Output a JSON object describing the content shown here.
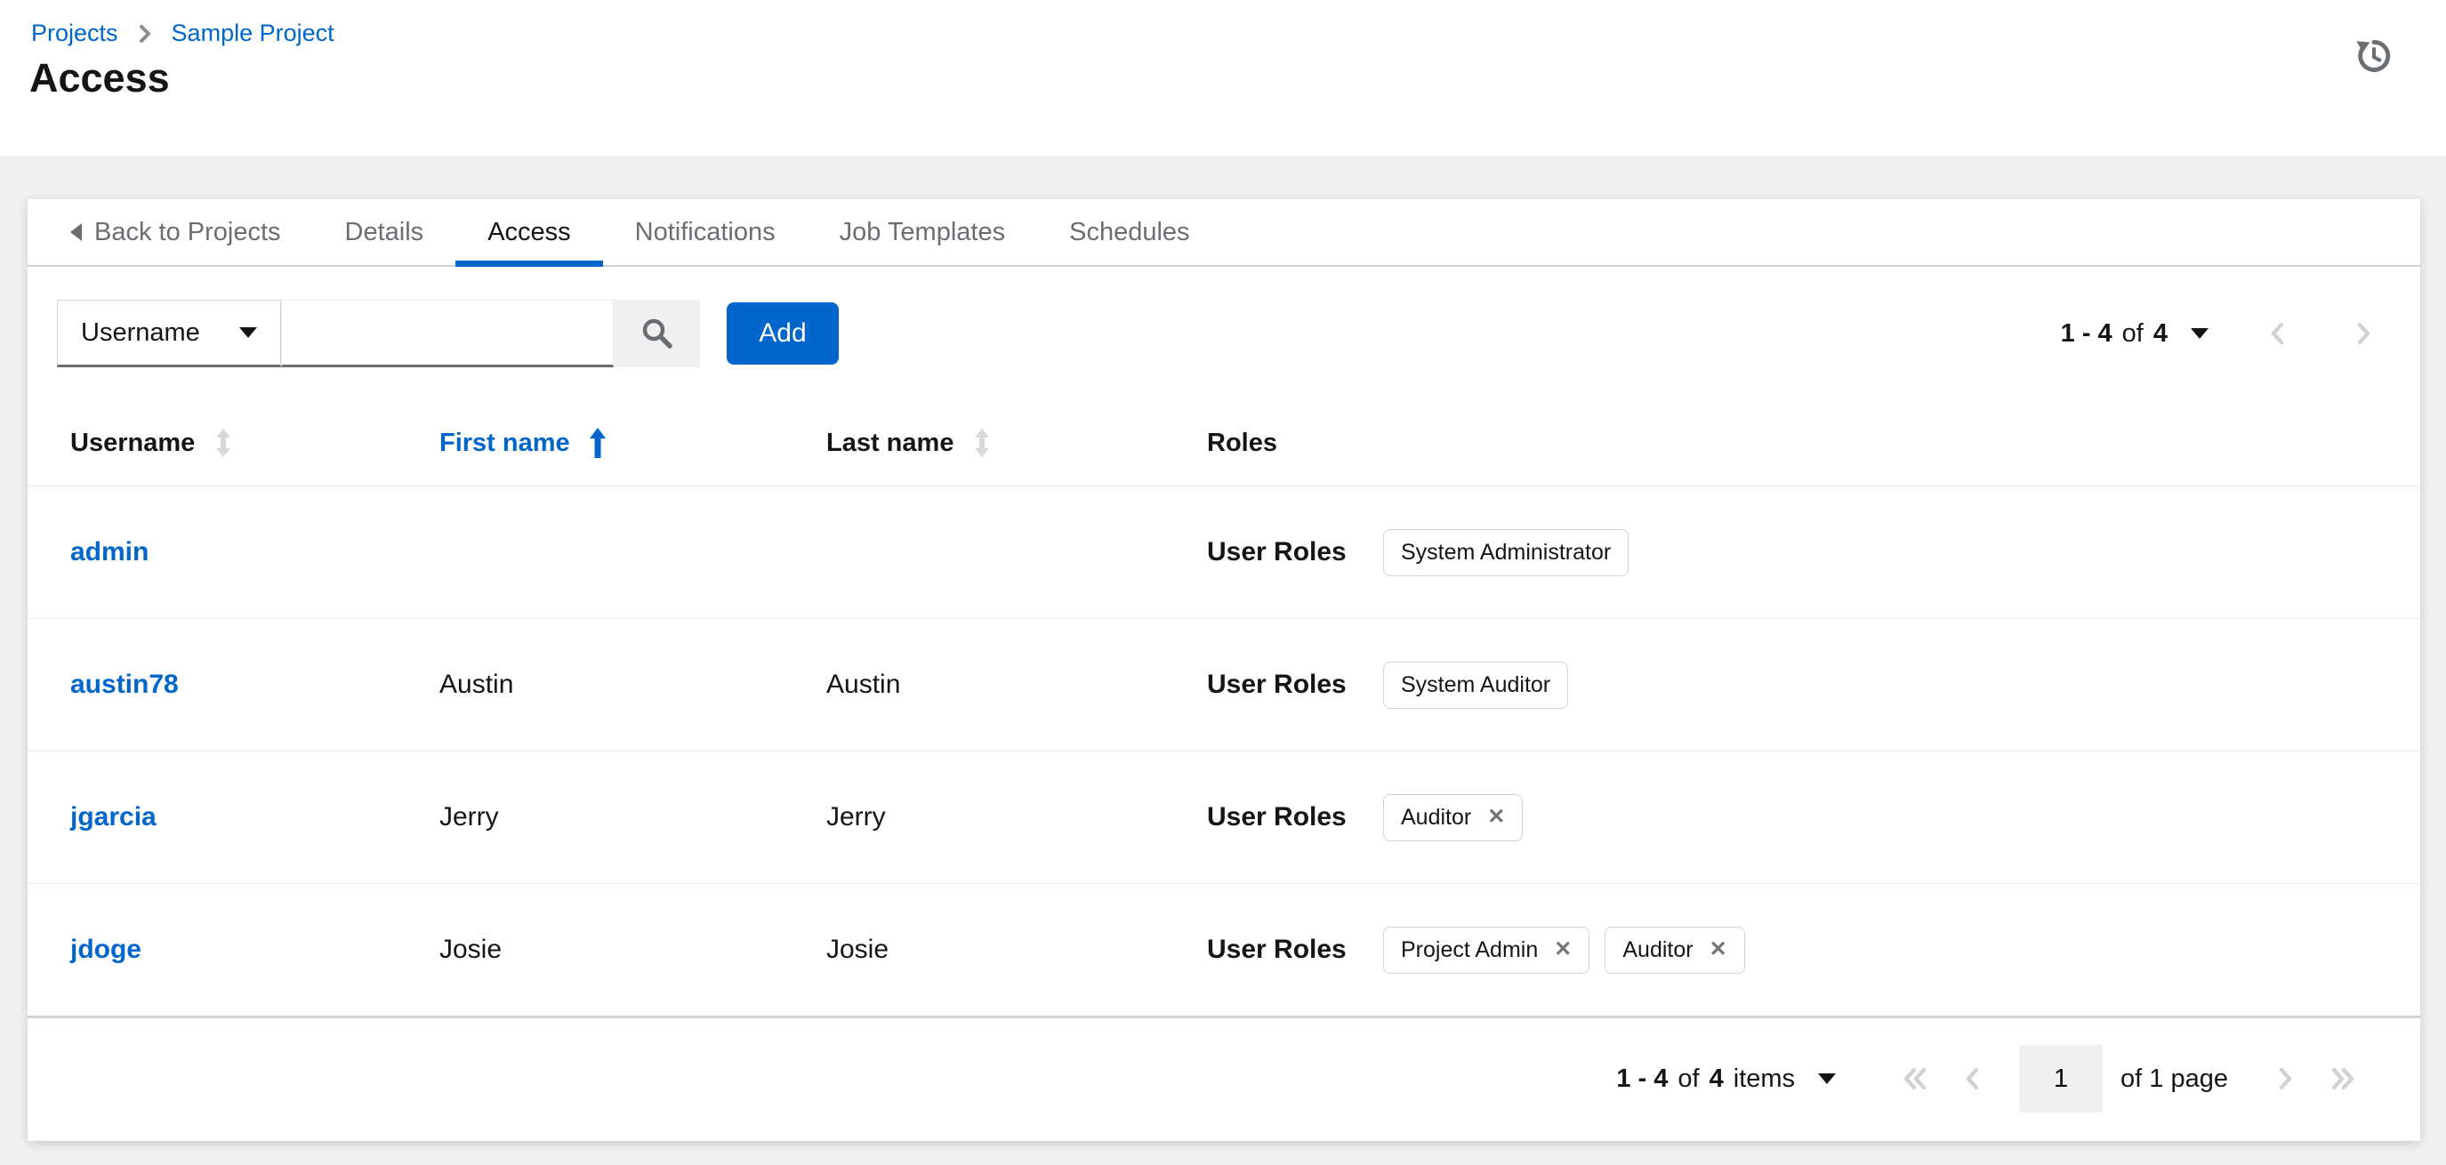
{
  "header": {
    "breadcrumb": [
      {
        "label": "Projects"
      },
      {
        "label": "Sample Project"
      }
    ],
    "title": "Access"
  },
  "tabs": {
    "back_label": "Back to Projects",
    "active": "Access",
    "items": [
      {
        "label": "Details"
      },
      {
        "label": "Access"
      },
      {
        "label": "Notifications"
      },
      {
        "label": "Job Templates"
      },
      {
        "label": "Schedules"
      }
    ]
  },
  "toolbar": {
    "filter_select": {
      "value": "Username"
    },
    "search_input": {
      "value": "",
      "placeholder": ""
    },
    "add_button_label": "Add",
    "pagination": {
      "range": "1 - 4",
      "of_word": "of",
      "total": "4"
    }
  },
  "table": {
    "columns": [
      {
        "label": "Username",
        "sortable": true,
        "sorted": "none"
      },
      {
        "label": "First name",
        "sortable": true,
        "sorted": "asc"
      },
      {
        "label": "Last name",
        "sortable": true,
        "sorted": "none"
      },
      {
        "label": "Roles",
        "sortable": false
      }
    ],
    "role_label": "User Roles",
    "rows": [
      {
        "username": "admin",
        "first_name": "",
        "last_name": "",
        "roles": [
          {
            "label": "System Administrator",
            "removable": false
          }
        ]
      },
      {
        "username": "austin78",
        "first_name": "Austin",
        "last_name": "Austin",
        "roles": [
          {
            "label": "System Auditor",
            "removable": false
          }
        ]
      },
      {
        "username": "jgarcia",
        "first_name": "Jerry",
        "last_name": "Jerry",
        "roles": [
          {
            "label": "Auditor",
            "removable": true
          }
        ]
      },
      {
        "username": "jdoge",
        "first_name": "Josie",
        "last_name": "Josie",
        "roles": [
          {
            "label": "Project Admin",
            "removable": true
          },
          {
            "label": "Auditor",
            "removable": true
          }
        ]
      }
    ]
  },
  "footer_pagination": {
    "range": "1 - 4",
    "of_word": "of",
    "total": "4",
    "items_word": "items",
    "current_page": "1",
    "page_count_label": "of 1 page"
  },
  "icons": {
    "remove_glyph": "✕"
  },
  "colors": {
    "accent": "#0066cc",
    "text": "#151515",
    "muted_text": "#6a6e73",
    "border": "#d2d2d2",
    "row_border": "#ebebeb",
    "page_bg": "#f0f0f0",
    "input_underline": "#6a6e73",
    "disabled_chevron": "#d2d2d2"
  }
}
